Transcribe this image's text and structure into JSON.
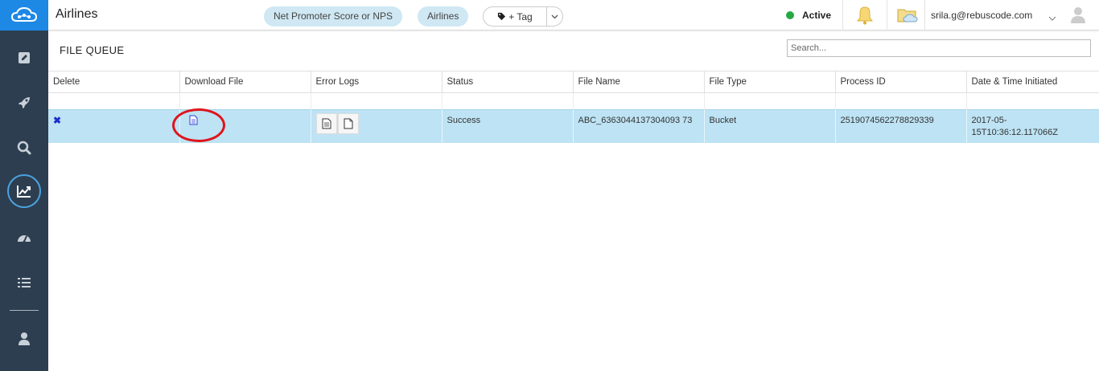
{
  "app": {
    "title": "Airlines"
  },
  "header": {
    "pills": [
      "Net Promoter Score or NPS",
      "Airlines"
    ],
    "tag_label": "+ Tag",
    "status_label": "Active",
    "user_email": "srila.g@rebuscode.com"
  },
  "colors": {
    "sidebar": "#2d3e50",
    "logo_bg": "#1e88e5",
    "row_highlight": "#bde3f4",
    "status_active": "#27a844",
    "annotation_circle": "#e0141b"
  },
  "page": {
    "title": "FILE QUEUE",
    "search_placeholder": "Search..."
  },
  "table": {
    "columns": [
      "Delete",
      "Download File",
      "Error Logs",
      "Status",
      "File Name",
      "File Type",
      "Process ID",
      "Date & Time Initiated"
    ],
    "rows": [
      {
        "status": "Success",
        "file_name": "ABC_6363044137304093 73",
        "file_type": "Bucket",
        "process_id": "2519074562278829339",
        "datetime": "2017-05- 15T10:36:12.117066Z"
      }
    ]
  }
}
